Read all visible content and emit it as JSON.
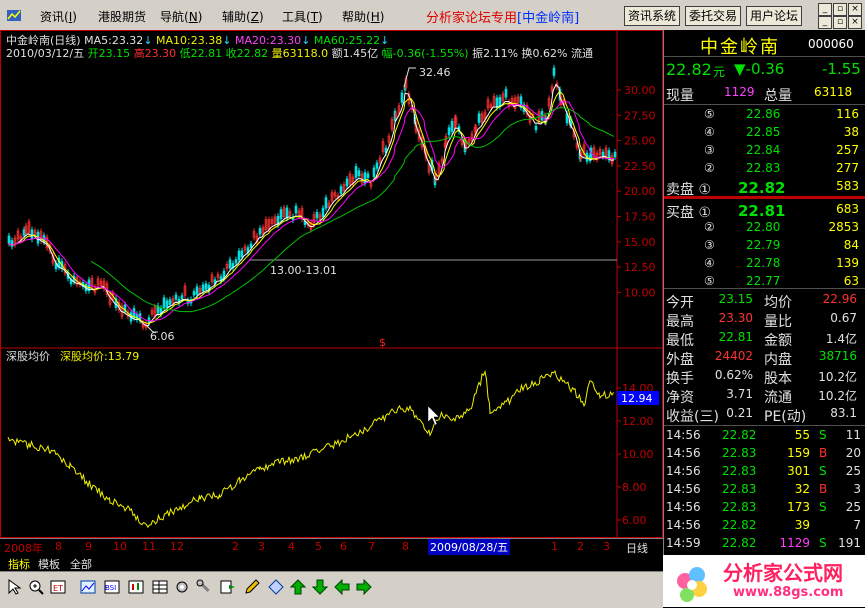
{
  "menu": {
    "items": [
      "资讯",
      "港股期货",
      "导航",
      "辅助",
      "工具",
      "帮助"
    ],
    "hotkeys": [
      "I",
      "W",
      "N",
      "Z",
      "T",
      "H"
    ],
    "forum_text": "分析家论坛专用",
    "forum_stock": "[中金岭南]",
    "sys_buttons": [
      "资讯系统",
      "委托交易",
      "用户论坛"
    ]
  },
  "chart": {
    "header_name": "中金岭南(日线)",
    "ma5": "MA5:23.32",
    "ma10": "MA10:23.38",
    "ma20": "MA20:23.30",
    "ma60": "MA60:25.22",
    "date_line": "2010/03/12/五",
    "open": "开23.15",
    "high": "高23.30",
    "low": "低22.81",
    "close": "收22.82",
    "volume": "量63118.0",
    "amount": "额1.45亿",
    "change": "幅-0.36(-1.55%)",
    "amplitude": "振2.11%",
    "turnover": "换0.62%",
    "circulation": "流通",
    "annot_high": "32.46",
    "annot_low": "6.06",
    "annot_range": "13.00-13.01",
    "y_axis_upper": [
      "30.00",
      "27.50",
      "25.00",
      "22.50",
      "20.00",
      "17.50",
      "15.00",
      "12.50",
      "10.00"
    ],
    "lower_title": "深股均价",
    "lower_value": "深股均价:13.79",
    "lower_tag": "12.94",
    "y_axis_lower": [
      "14.00",
      "12.00",
      "10.00",
      "8.00",
      "6.00"
    ],
    "dollar_mark": "$",
    "date_labels": [
      "2008年",
      "8",
      "9",
      "10",
      "11",
      "12",
      "2",
      "3",
      "4",
      "5",
      "6",
      "7",
      "8",
      "1",
      "2",
      "3"
    ],
    "date_highlight": "2009/08/28/五",
    "period": "日线",
    "tabs": [
      "指标",
      "模板",
      "全部"
    ]
  },
  "quote": {
    "name": "中金岭南",
    "code": "000060",
    "price": "22.82",
    "unit": "元",
    "change": "▼-0.36",
    "change2": "-1.55",
    "volume_label": "现量",
    "volume_value": "1129",
    "total_label": "总量",
    "total_value": "63118",
    "sell": [
      {
        "mark": "⑤",
        "price": "22.86",
        "vol": "116"
      },
      {
        "mark": "④",
        "price": "22.85",
        "vol": "38"
      },
      {
        "mark": "③",
        "price": "22.84",
        "vol": "257"
      },
      {
        "mark": "②",
        "price": "22.83",
        "vol": "277"
      },
      {
        "mark": "卖盘 ①",
        "price": "22.82",
        "vol": "583"
      }
    ],
    "buy": [
      {
        "mark": "买盘 ①",
        "price": "22.81",
        "vol": "683"
      },
      {
        "mark": "②",
        "price": "22.80",
        "vol": "2853"
      },
      {
        "mark": "③",
        "price": "22.79",
        "vol": "84"
      },
      {
        "mark": "④",
        "price": "22.78",
        "vol": "139"
      },
      {
        "mark": "⑤",
        "price": "22.77",
        "vol": "63"
      }
    ],
    "stats": [
      {
        "l1": "今开",
        "v1": "23.15",
        "l2": "均价",
        "v2": "22.96"
      },
      {
        "l1": "最高",
        "v1": "23.30",
        "l2": "量比",
        "v2": "0.67"
      },
      {
        "l1": "最低",
        "v1": "22.81",
        "l2": "金额",
        "v2": "1.4亿"
      },
      {
        "l1": "外盘",
        "v1": "24402",
        "l2": "内盘",
        "v2": "38716"
      },
      {
        "l1": "换手",
        "v1": "0.62%",
        "l2": "股本",
        "v2": "10.2亿"
      },
      {
        "l1": "净资",
        "v1": "3.71",
        "l2": "流通",
        "v2": "10.2亿"
      },
      {
        "l1": "收益(三)",
        "v1": "0.21",
        "l2": "PE(动)",
        "v2": "83.1"
      }
    ],
    "ticks": [
      {
        "time": "14:56",
        "price": "22.82",
        "vol": "55",
        "bs": "S",
        "n": "11"
      },
      {
        "time": "14:56",
        "price": "22.83",
        "vol": "159",
        "bs": "B",
        "n": "20"
      },
      {
        "time": "14:56",
        "price": "22.83",
        "vol": "301",
        "bs": "S",
        "n": "25"
      },
      {
        "time": "14:56",
        "price": "22.83",
        "vol": "32",
        "bs": "B",
        "n": "3"
      },
      {
        "time": "14:56",
        "price": "22.83",
        "vol": "173",
        "bs": "S",
        "n": "25"
      },
      {
        "time": "14:56",
        "price": "22.82",
        "vol": "39",
        "bs": "",
        "n": "7"
      },
      {
        "time": "14:59",
        "price": "22.82",
        "vol": "1129",
        "bs": "S",
        "n": "191"
      }
    ]
  },
  "logo": {
    "text": "分析家公式网",
    "url": "www.88gs.com"
  }
}
